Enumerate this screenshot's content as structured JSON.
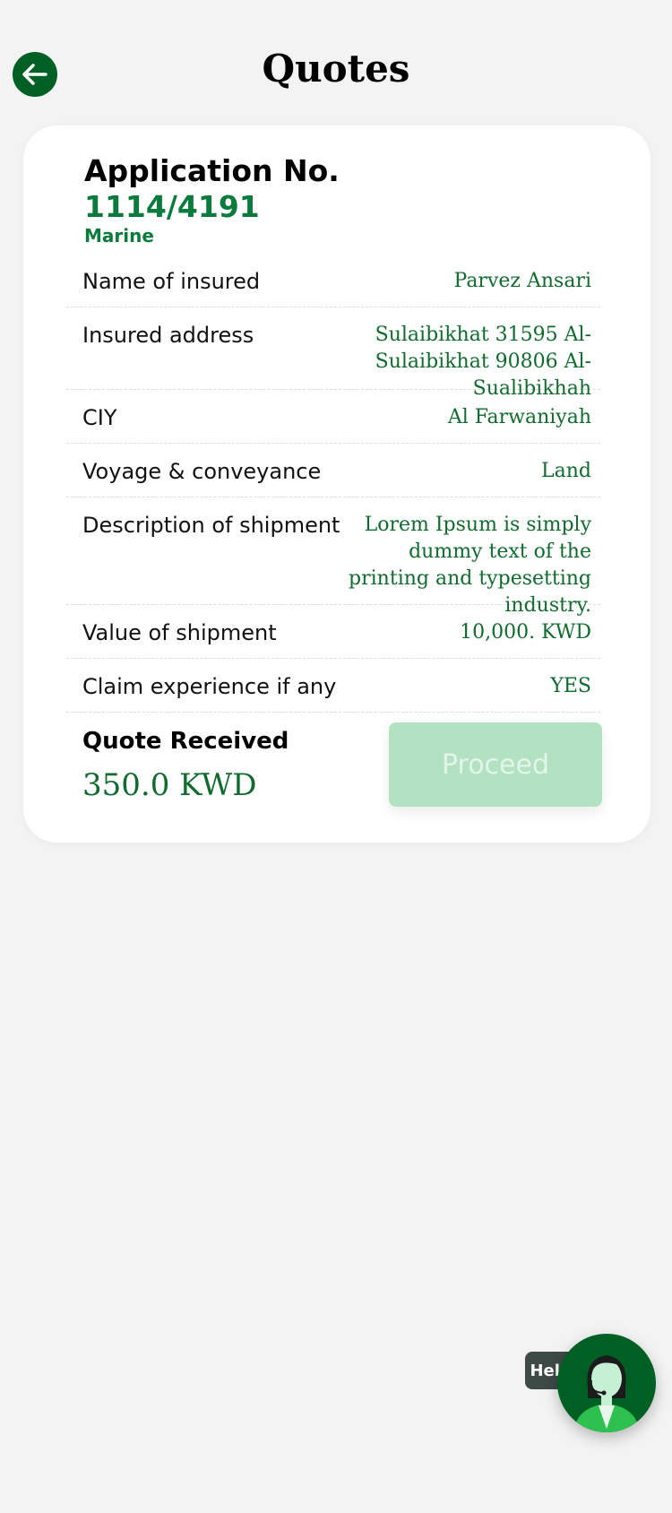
{
  "header": {
    "title": "Quotes",
    "back_icon": "arrow-left-icon"
  },
  "application": {
    "label": "Application No.",
    "number": "1114/4191",
    "type": "Marine"
  },
  "details": [
    {
      "label": "Name of insured",
      "value": "Parvez Ansari"
    },
    {
      "label": "Insured address",
      "value": "Sulaibikhat 31595 Al-Sulaibikhat 90806 Al-Sualibikhah"
    },
    {
      "label": "CIY",
      "value": "Al Farwaniyah"
    },
    {
      "label": "Voyage & conveyance",
      "value": "Land"
    },
    {
      "label": "Description of shipment",
      "value": "Lorem Ipsum is simply dummy text of the printing and typesetting industry."
    },
    {
      "label": "Value of shipment",
      "value": "10,000. KWD"
    },
    {
      "label": "Claim experience if any",
      "value": "YES"
    }
  ],
  "quote": {
    "label": "Quote Received",
    "amount": "350.0 KWD"
  },
  "actions": {
    "proceed_label": "Proceed"
  },
  "help": {
    "label": "Help ?",
    "avatar_icon": "support-agent-icon"
  },
  "colors": {
    "primary": "#005f23",
    "accent_text": "#0f6b2e",
    "app_number": "#0a7a3d",
    "proceed_disabled": "#b3e2c3",
    "background": "#f3f3f3"
  }
}
